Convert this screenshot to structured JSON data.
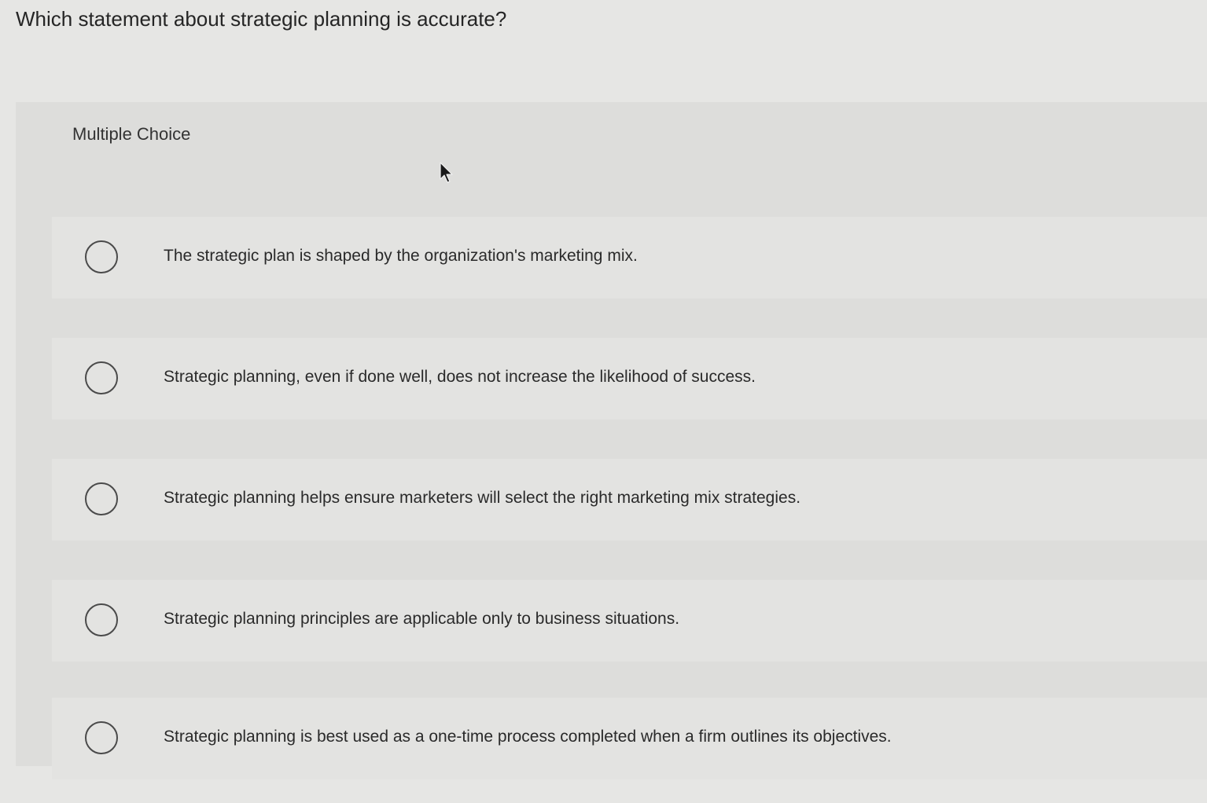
{
  "question": {
    "text": "Which statement about strategic planning is accurate?"
  },
  "panel": {
    "type_label": "Multiple Choice",
    "options": [
      {
        "text": "The strategic plan is shaped by the organization's marketing mix."
      },
      {
        "text": "Strategic planning, even if done well, does not increase the likelihood of success."
      },
      {
        "text": "Strategic planning helps ensure marketers will select the right marketing mix strategies."
      },
      {
        "text": "Strategic planning principles are applicable only to business situations."
      },
      {
        "text": "Strategic planning is best used as a one-time process completed when a firm outlines its objectives."
      }
    ]
  },
  "icons": {
    "radio": "radio-unchecked-icon",
    "cursor": "mouse-pointer-icon"
  },
  "colors": {
    "background": "#e6e6e4",
    "panel": "#dddddb",
    "text": "#2b2b2b"
  }
}
